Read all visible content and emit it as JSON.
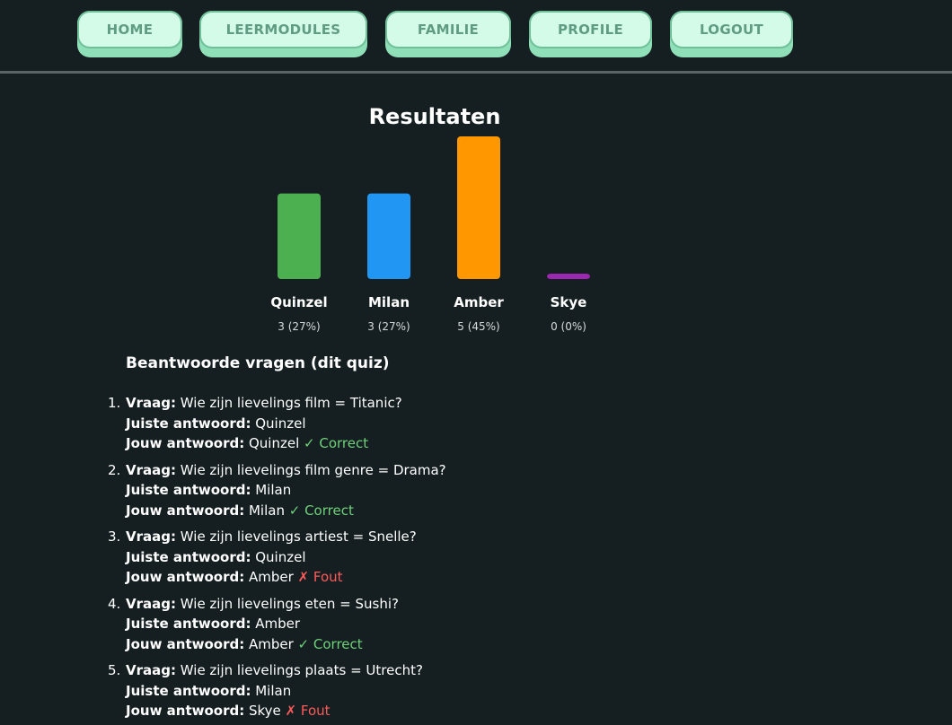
{
  "nav": {
    "items": [
      {
        "label": "HOME"
      },
      {
        "label": "LEERMODULES"
      },
      {
        "label": "FAMILIE"
      },
      {
        "label": "PROFILE"
      },
      {
        "label": "LOGOUT"
      }
    ]
  },
  "chart_data": {
    "type": "bar",
    "title": "Resultaten",
    "categories": [
      "Quinzel",
      "Milan",
      "Amber",
      "Skye"
    ],
    "values": [
      3,
      3,
      5,
      0
    ],
    "value_labels": [
      "3 (27%)",
      "3 (27%)",
      "5 (45%)",
      "0 (0%)"
    ],
    "colors": [
      "#4caf50",
      "#2196f3",
      "#ff9800",
      "#9c27b0"
    ],
    "ylim": [
      0,
      5
    ],
    "grid": false,
    "xlabel": "",
    "ylabel": ""
  },
  "answers": {
    "title": "Beantwoorde vragen (dit quiz)",
    "question_label": "Vraag:",
    "correct_label": "Juiste antwoord:",
    "your_label": "Jouw antwoord:",
    "items": [
      {
        "num": "1.",
        "question": "Wie zijn lievelings film = Titanic?",
        "correct": "Quinzel",
        "yours": "Quinzel",
        "verdict": "✓ Correct",
        "ok": true
      },
      {
        "num": "2.",
        "question": "Wie zijn lievelings film genre = Drama?",
        "correct": "Milan",
        "yours": "Milan",
        "verdict": "✓ Correct",
        "ok": true
      },
      {
        "num": "3.",
        "question": "Wie zijn lievelings artiest = Snelle?",
        "correct": "Quinzel",
        "yours": "Amber",
        "verdict": "✗ Fout",
        "ok": false
      },
      {
        "num": "4.",
        "question": "Wie zijn lievelings eten = Sushi?",
        "correct": "Amber",
        "yours": "Amber",
        "verdict": "✓ Correct",
        "ok": true
      },
      {
        "num": "5.",
        "question": "Wie zijn lievelings plaats = Utrecht?",
        "correct": "Milan",
        "yours": "Skye",
        "verdict": "✗ Fout",
        "ok": false
      }
    ]
  }
}
